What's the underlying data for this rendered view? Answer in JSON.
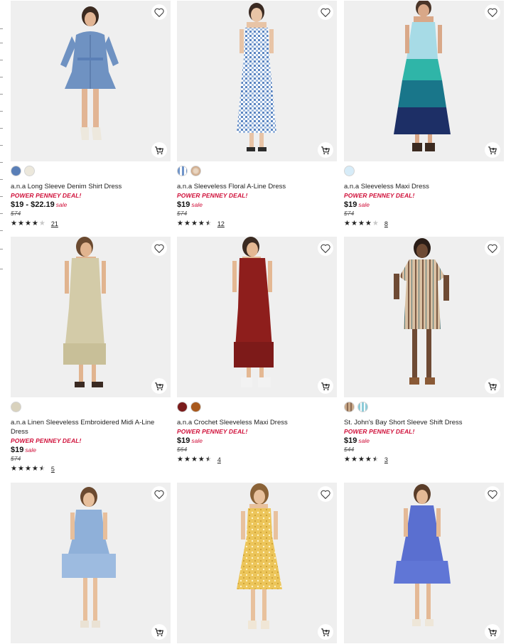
{
  "colors": {
    "accent": "#d0103a",
    "image_bg": "#efefef"
  },
  "products": [
    {
      "title": "a.n.a Long Sleeve Denim Shirt Dress",
      "deal": "POWER PENNEY DEAL!",
      "price": "$19 - $22.19",
      "sale_label": "sale",
      "original_price": "$74",
      "rating": 4.0,
      "review_count": "21",
      "swatches": [
        "#5a7fb7",
        "#ece8dc"
      ],
      "icons": [
        "heart-icon",
        "add-to-cart-icon"
      ]
    },
    {
      "title": "a.n.a Sleeveless Floral A-Line Dress",
      "deal": "POWER PENNEY DEAL!",
      "price": "$19",
      "sale_label": "sale",
      "original_price": "$74",
      "rating": 4.5,
      "review_count": "12",
      "swatches": [
        "#6f94c9",
        "#d6b79a"
      ],
      "icons": [
        "heart-icon",
        "add-to-cart-icon"
      ]
    },
    {
      "title": "a.n.a Sleeveless Maxi Dress",
      "deal": "POWER PENNEY DEAL!",
      "price": "$19",
      "sale_label": "sale",
      "original_price": "$74",
      "rating": 4.0,
      "review_count": "8",
      "swatches": [
        "#d7ecf8"
      ],
      "icons": [
        "heart-icon",
        "add-to-cart-icon"
      ]
    },
    {
      "title": "a.n.a Linen Sleeveless Embroidered Midi A-Line Dress",
      "deal": "POWER PENNEY DEAL!",
      "price": "$19",
      "sale_label": "sale",
      "original_price": "$74",
      "rating": 4.5,
      "review_count": "5",
      "swatches": [
        "#d9d2bd"
      ],
      "icons": [
        "heart-icon",
        "add-to-cart-icon"
      ]
    },
    {
      "title": "a.n.a Crochet Sleeveless Maxi Dress",
      "deal": "POWER PENNEY DEAL!",
      "price": "$19",
      "sale_label": "sale",
      "original_price": "$64",
      "rating": 4.5,
      "review_count": "4",
      "swatches": [
        "#7a1b1b",
        "#a8581c"
      ],
      "icons": [
        "heart-icon",
        "add-to-cart-icon"
      ]
    },
    {
      "title": "St. John's Bay Short Sleeve Shift Dress",
      "deal": "POWER PENNEY DEAL!",
      "price": "$19",
      "sale_label": "sale",
      "original_price": "$44",
      "rating": 4.5,
      "review_count": "3",
      "swatches": [
        "#c9a98a",
        "#8ccbd8"
      ],
      "icons": [
        "heart-icon",
        "add-to-cart-icon"
      ]
    },
    {
      "icons": [
        "heart-icon",
        "add-to-cart-icon"
      ]
    },
    {
      "icons": [
        "heart-icon",
        "add-to-cart-icon"
      ]
    },
    {
      "icons": [
        "heart-icon",
        "add-to-cart-icon"
      ]
    }
  ]
}
